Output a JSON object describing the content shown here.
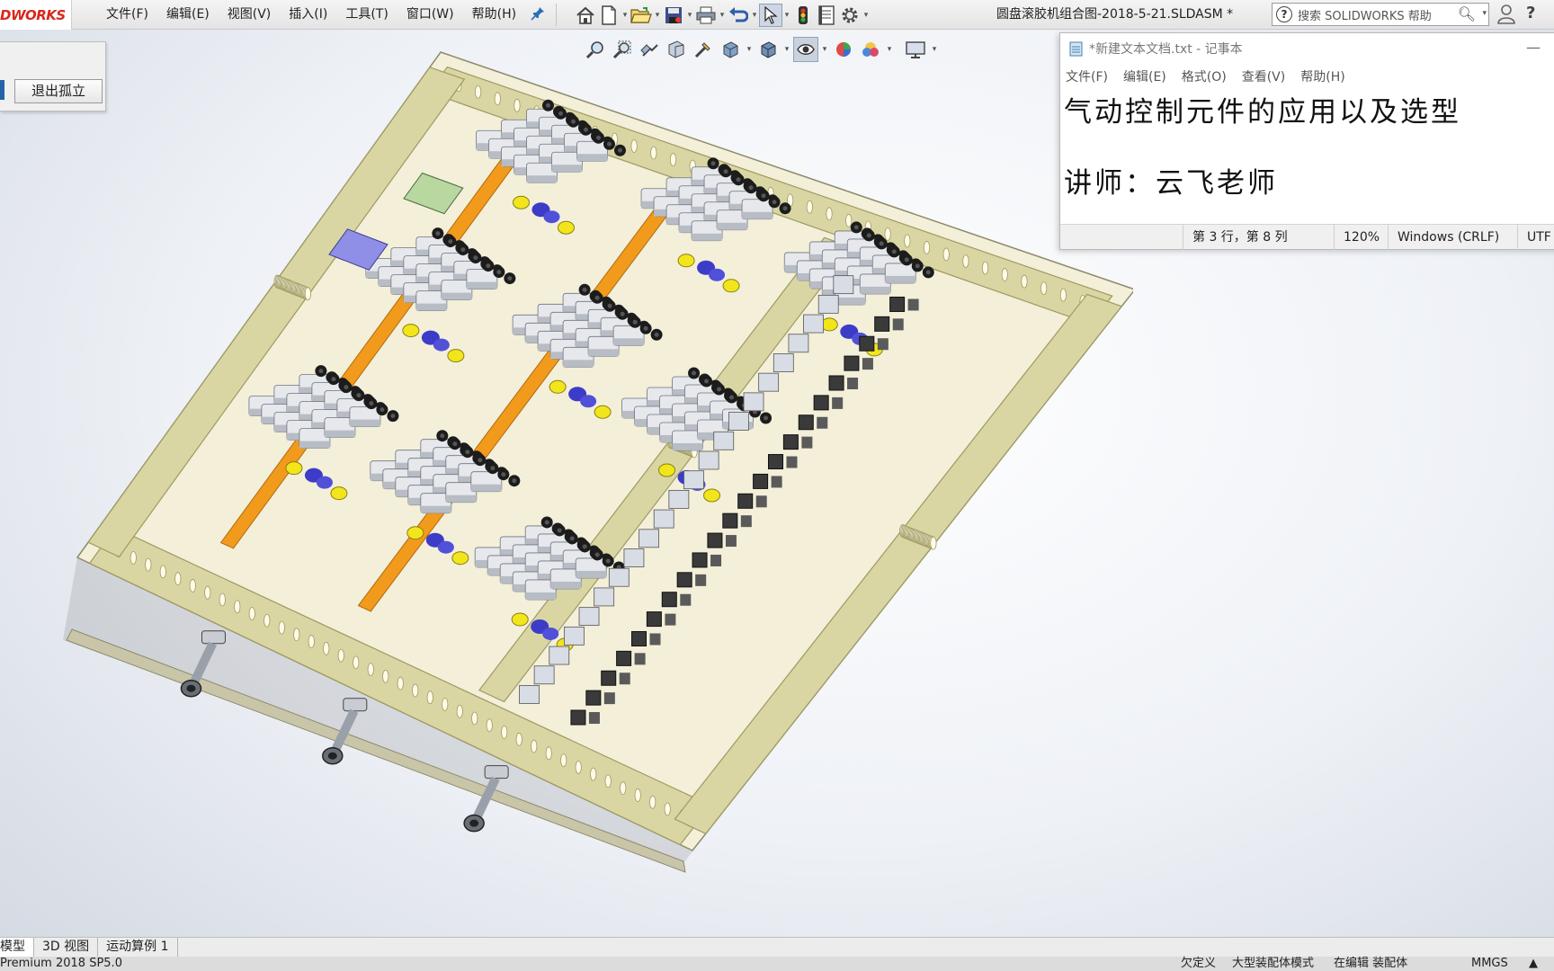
{
  "app": {
    "logo_text": "DWORKS",
    "brand_color": "#d9261c",
    "menu": [
      "文件(F)",
      "编辑(E)",
      "视图(V)",
      "插入(I)",
      "工具(T)",
      "窗口(W)",
      "帮助(H)"
    ],
    "document_title": "圆盘滚胶机组合图-2018-5-21.SLDASM *",
    "search_placeholder": "搜索 SOLIDWORKS 帮助",
    "toolbar_icons": [
      "home-icon",
      "new-document-icon",
      "open-folder-icon",
      "save-icon",
      "print-icon",
      "undo-icon",
      "select-arrow-icon",
      "traffic-light-icon",
      "file-properties-icon",
      "options-gear-icon"
    ],
    "help_symbol": "?"
  },
  "isolate_panel": {
    "exit_button_label": "退出孤立"
  },
  "view_toolbar": {
    "icons": [
      "zoom-to-fit-icon",
      "zoom-to-area-icon",
      "previous-view-icon",
      "section-view-icon",
      "dynamic-annotation-icon",
      "view-orientation-icon",
      "display-style-icon",
      "hide-show-items-icon",
      "edit-appearance-icon",
      "apply-scene-icon",
      "view-settings-icon"
    ]
  },
  "notepad": {
    "title": "*新建文本文档.txt - 记事本",
    "menu": [
      "文件(F)",
      "编辑(E)",
      "格式(O)",
      "查看(V)",
      "帮助(H)"
    ],
    "line1": "气动控制元件的应用以及选型",
    "line2": "讲师：云飞老师",
    "status": {
      "position": "第 3 行，第 8 列",
      "zoom": "120%",
      "line_ending": "Windows (CRLF)",
      "encoding": "UTF"
    }
  },
  "model_colors": {
    "frame": "#d9d6a3",
    "frame_dark": "#9e9a62",
    "base": "#f3efd9",
    "valve": "#e6e8ec",
    "valve_shade": "#b8bcc4",
    "fitting": "#1c1c1c",
    "muffler": "#f2e51c",
    "blue": "#3c3cc8",
    "rail": "#f29a1c"
  },
  "tabs": [
    "模型",
    "3D 视图",
    "运动算例 1"
  ],
  "status_bar": {
    "left": "Premium 2018 SP5.0",
    "undefined": "欠定义",
    "large_mode": "大型装配体模式",
    "editing": "在编辑 装配体",
    "units": "MMGS",
    "arrow": "▲"
  }
}
